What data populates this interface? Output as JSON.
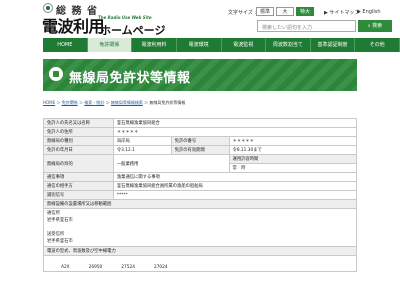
{
  "header": {
    "ministry": "総 務 省",
    "logo_main": "電波利用",
    "logo_sub": "The Radio Use Web Site",
    "logo_hp": "ホームページ",
    "font_size_label": "文字サイズ :",
    "font_sizes": [
      "標準",
      "大",
      "特大"
    ],
    "sitemap": "▶ サイトマップ",
    "english": "▶ English",
    "search_placeholder": "検索したい語句を入力",
    "search_button": "検索"
  },
  "nav": {
    "items": [
      "HOME",
      "免許関係",
      "電波利用料",
      "電波環境",
      "電波監視",
      "周波数割当て",
      "基準認証制度",
      "その他"
    ],
    "active_index": 1
  },
  "banner": {
    "title": "無線局免許状等情報"
  },
  "breadcrumb": {
    "items": [
      "HOME",
      "免許関係",
      "検索・統計",
      "無線局等情報検索",
      "無線局免許状等情報"
    ],
    "separator": "＞"
  },
  "record": {
    "licensee_name_label": "免許人の氏名又は名称",
    "licensee_name_value": "釜石無線漁業協同組合",
    "licensee_address_label": "免許人の住所",
    "licensee_address_value": "＊＊＊＊＊",
    "station_type_label": "無線局の種別",
    "station_type_value": "海岸局",
    "license_number_label": "免許の番号",
    "license_number_value": "＊＊＊＊＊",
    "license_date_label": "免許の年月日",
    "license_date_value": "令3.12.1",
    "validity_label": "免許の有効期間",
    "validity_value": "令8.11.30まで",
    "purpose_label": "無線局の目的",
    "purpose_value": "一般業務用",
    "operating_hours_label": "運用許容時間",
    "operating_hours_value": "常　時",
    "comm_matters_label": "通信事項",
    "comm_matters_value": "漁業通信に関する事項",
    "comm_partner_label": "通信の相手方",
    "comm_partner_value": "釜石無線漁業協同組合員所属の漁船の船舶局",
    "callsign_label": "識別信号",
    "callsign_value": "*****",
    "location_header": "無線設備の設置場所又は移動範囲",
    "location_lines": [
      "通信所",
      "岩手県釜石市",
      "",
      "送受信所",
      "岩手県釜石市"
    ],
    "emission_header": "電波の型式、周波数及び空中線電力",
    "frequencies": [
      "A2X",
      "26950",
      "27524",
      "27024"
    ]
  }
}
